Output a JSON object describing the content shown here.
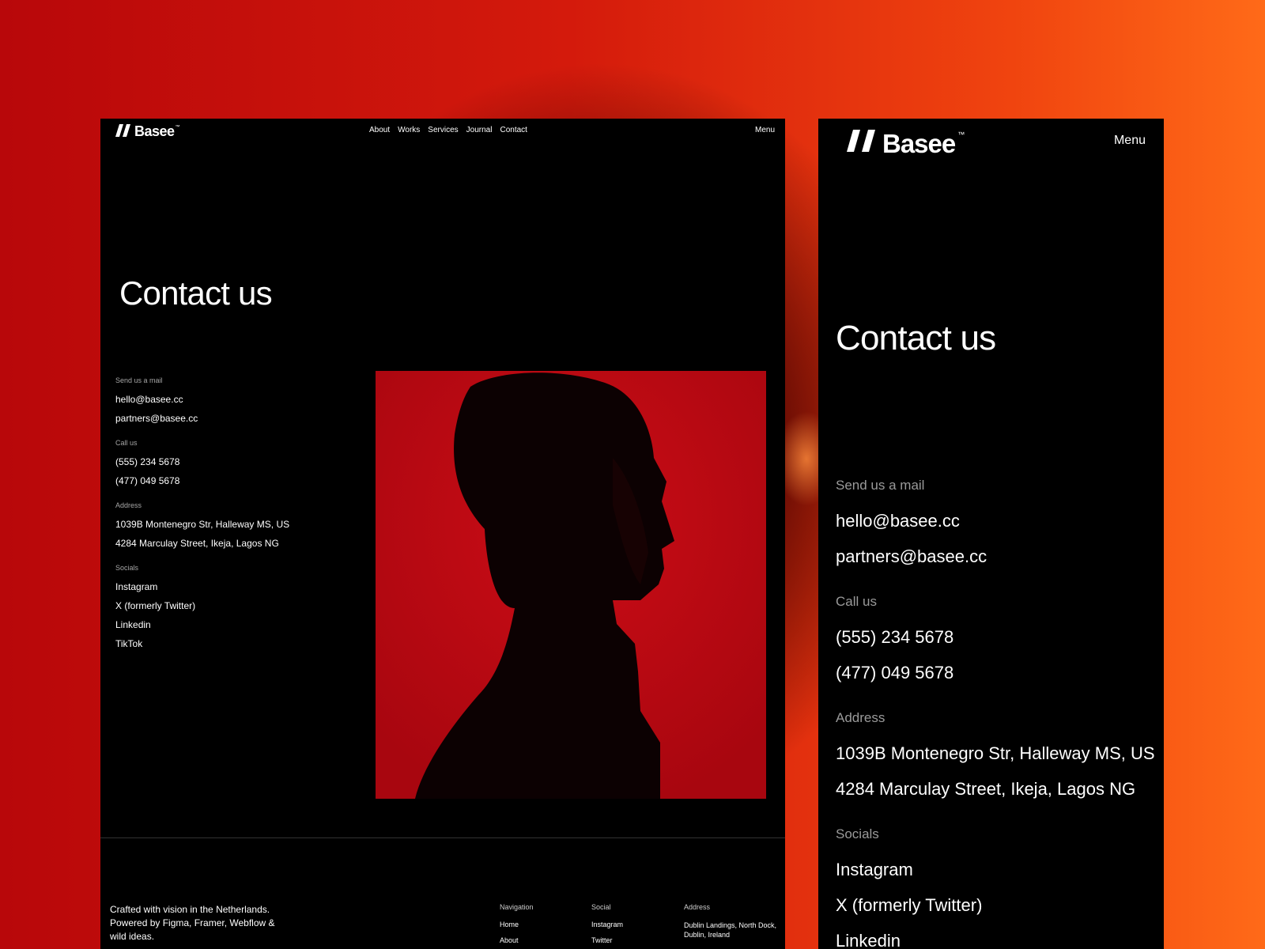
{
  "brand": {
    "name": "Basee",
    "tm": "™"
  },
  "desktop": {
    "nav_links": [
      "About",
      "Works",
      "Services",
      "Journal",
      "Contact"
    ],
    "menu_label": "Menu",
    "title": "Contact us",
    "sections": [
      {
        "label": "Send us a mail",
        "items": [
          "hello@basee.cc",
          "partners@basee.cc"
        ]
      },
      {
        "label": "Call us",
        "items": [
          "(555) 234 5678",
          "(477) 049 5678"
        ]
      },
      {
        "label": "Address",
        "items": [
          "1039B Montenegro Str, Halleway MS, US",
          "4284 Marculay Street, Ikeja, Lagos NG"
        ]
      },
      {
        "label": "Socials",
        "items": [
          "Instagram",
          "X (formerly Twitter)",
          "Linkedin",
          "TikTok"
        ]
      }
    ],
    "footer": {
      "tagline": "Crafted with vision in the Netherlands. Powered by Figma, Framer, Webflow & wild ideas.",
      "navigation": {
        "heading": "Navigation",
        "items": [
          "Home",
          "About"
        ]
      },
      "social": {
        "heading": "Social",
        "items": [
          "Instagram",
          "Twitter"
        ]
      },
      "address": {
        "heading": "Address",
        "lines": [
          "Dublin Landings, North Dock,",
          "Dublin, Ireland"
        ]
      }
    }
  },
  "mobile": {
    "menu_label": "Menu",
    "title": "Contact us",
    "sections": [
      {
        "label": "Send us a mail",
        "items": [
          "hello@basee.cc",
          "partners@basee.cc"
        ]
      },
      {
        "label": "Call us",
        "items": [
          "(555) 234 5678",
          "(477) 049 5678"
        ]
      },
      {
        "label": "Address",
        "items": [
          "1039B Montenegro Str, Halleway MS, US",
          "4284 Marculay Street, Ikeja, Lagos NG"
        ]
      },
      {
        "label": "Socials",
        "items": [
          "Instagram",
          "X (formerly Twitter)",
          "Linkedin"
        ]
      }
    ]
  },
  "colors": {
    "page_background": "#d41a0c",
    "panel": "#000000",
    "photo_background": "#c00a14",
    "muted_label": "#a6a6a6"
  },
  "icons": {
    "logo_mark": "double-slash-logo-icon"
  }
}
